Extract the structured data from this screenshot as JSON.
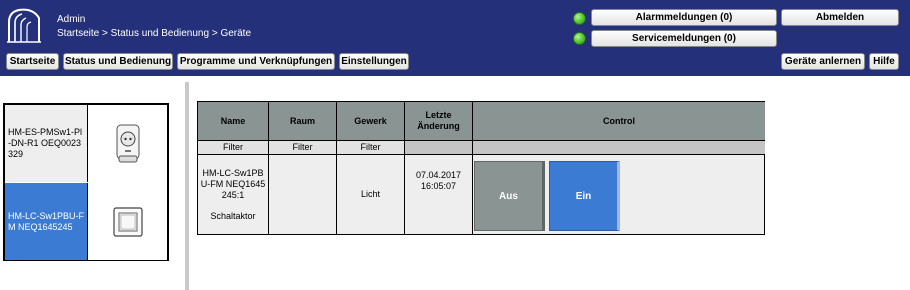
{
  "header": {
    "user": "Admin",
    "breadcrumb": "Startseite > Status und Bedienung > Geräte",
    "alarm_label": "Alarmmeldungen (0)",
    "service_label": "Servicemeldungen (0)",
    "logout_label": "Abmelden"
  },
  "nav": {
    "start": "Startseite",
    "status": "Status und Bedienung",
    "programs": "Programme und Verknüpfungen",
    "settings": "Einstellungen",
    "teach": "Geräte anlernen",
    "help": "Hilfe"
  },
  "devices": [
    {
      "name": "HM-ES-PMSw1-Pl-DN-R1 OEQ0023329",
      "icon": "plug-icon",
      "selected": false
    },
    {
      "name": "HM-LC-Sw1PBU-FM NEQ1645245",
      "icon": "wall-switch-icon",
      "selected": true
    }
  ],
  "table": {
    "headers": {
      "name": "Name",
      "room": "Raum",
      "trade": "Gewerk",
      "last_change": "Letzte Änderung",
      "control": "Control"
    },
    "filter_label": "Filter",
    "row": {
      "name": "HM-LC-Sw1PBU-FM NEQ1645245:1",
      "type": "Schaltaktor",
      "room": "",
      "trade": "Licht",
      "date": "07.04.2017",
      "time": "16:05:07",
      "off_label": "Aus",
      "on_label": "Ein"
    }
  },
  "colors": {
    "header_bg": "#24307a",
    "selected_bg": "#3c7bd4",
    "off_bg": "#8a9493",
    "on_bg": "#3c7bd4",
    "led_green": "#5cd035"
  }
}
